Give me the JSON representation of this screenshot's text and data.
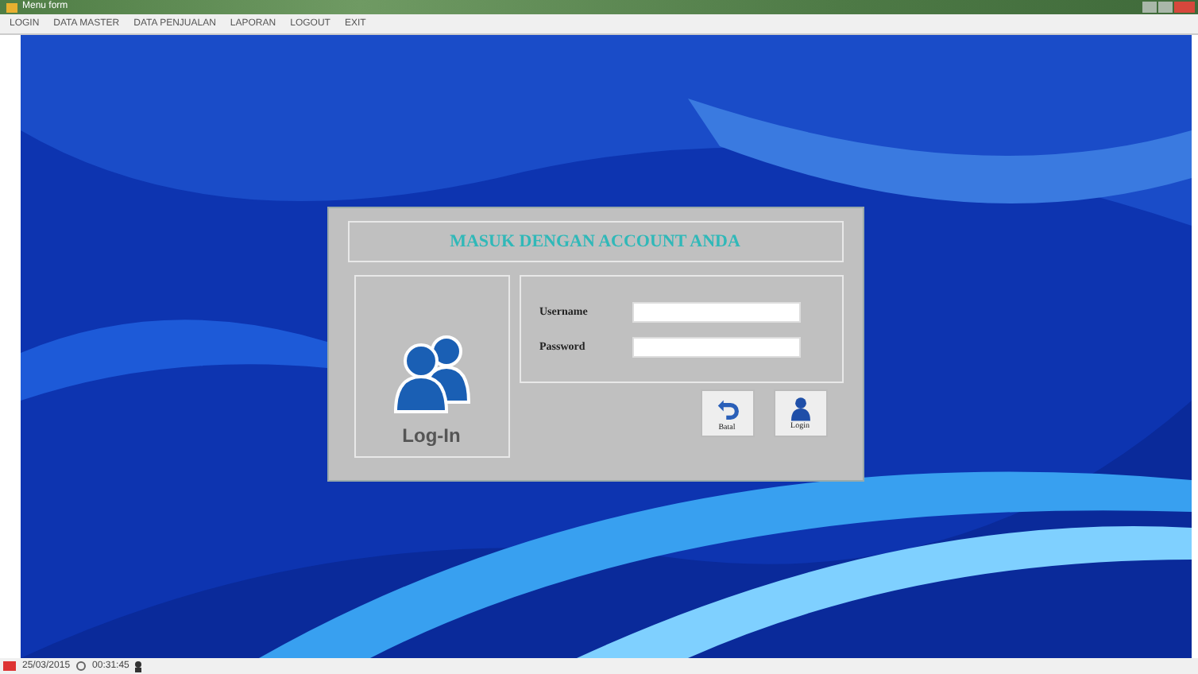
{
  "window": {
    "title": "Menu form"
  },
  "menu": [
    "LOGIN",
    "DATA MASTER",
    "DATA PENJUALAN",
    "LAPORAN",
    "LOGOUT",
    "EXIT"
  ],
  "dialog": {
    "heading": "MASUK DENGAN ACCOUNT ANDA",
    "logo_caption": "Log-In",
    "fields": [
      {
        "label": "Username"
      },
      {
        "label": "Password"
      }
    ],
    "buttons": [
      {
        "kind": "cancel",
        "label": "Batal"
      },
      {
        "kind": "login",
        "label": "Login"
      }
    ]
  },
  "status_bar": {
    "date": "25/03/2015",
    "time": "00:31:45"
  }
}
